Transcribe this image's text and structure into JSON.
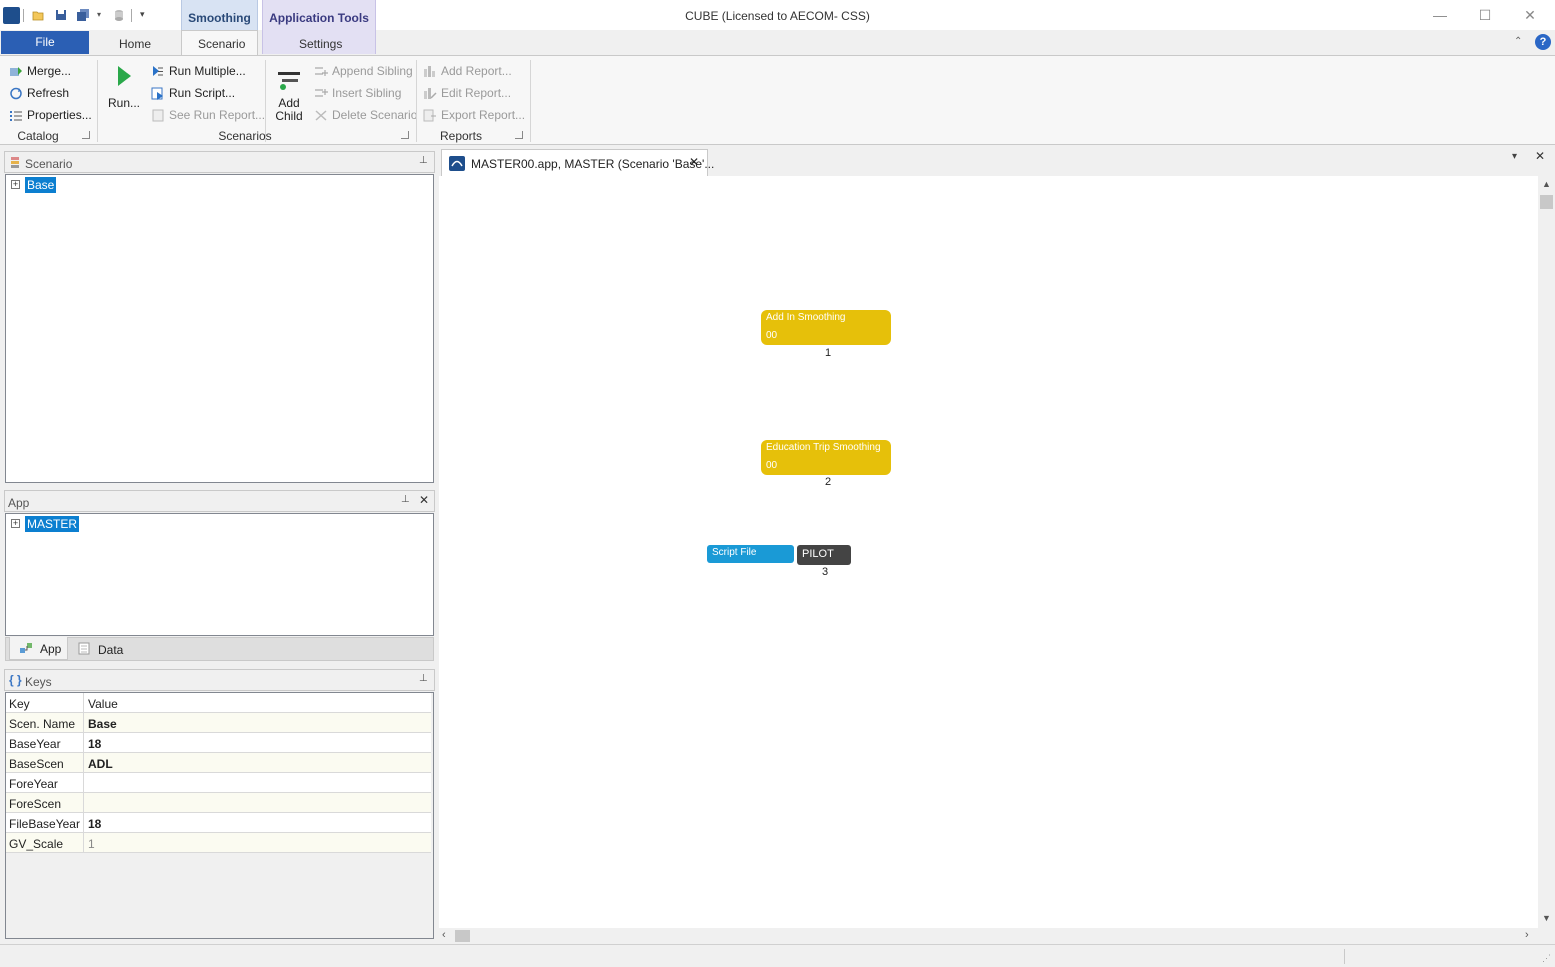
{
  "window": {
    "title": "CUBE (Licensed to AECOM- CSS)",
    "minimize": "—",
    "maximize": "☐",
    "close": "✕"
  },
  "context_tabs": {
    "smoothing": "Smoothing",
    "application_tools": "Application Tools"
  },
  "tabs": {
    "file": "File",
    "home": "Home",
    "scenario": "Scenario",
    "settings": "Settings"
  },
  "ribbon": {
    "catalog": {
      "label": "Catalog",
      "merge": "Merge...",
      "refresh": "Refresh",
      "properties": "Properties..."
    },
    "scenarios": {
      "label": "Scenarios",
      "run": "Run...",
      "run_multiple": "Run Multiple...",
      "run_script": "Run Script...",
      "see_run_report": "See Run Report...",
      "add_child_line1": "Add",
      "add_child_line2": "Child",
      "append_sibling": "Append Sibling",
      "insert_sibling": "Insert Sibling",
      "delete_scenario": "Delete Scenario"
    },
    "reports": {
      "label": "Reports",
      "add_report": "Add Report...",
      "edit_report": "Edit Report...",
      "export_report": "Export Report..."
    }
  },
  "scenario_panel": {
    "title": "Scenario",
    "root": "Base"
  },
  "app_panel": {
    "title": "App",
    "root": "MASTER",
    "tab_app": "App",
    "tab_data": "Data"
  },
  "keys_panel": {
    "title": "Keys",
    "header_key": "Key",
    "header_value": "Value",
    "rows": [
      {
        "key": "Scen. Name",
        "value": "Base"
      },
      {
        "key": "BaseYear",
        "value": "18"
      },
      {
        "key": "BaseScen",
        "value": "ADL"
      },
      {
        "key": "ForeYear",
        "value": ""
      },
      {
        "key": "ForeScen",
        "value": ""
      },
      {
        "key": "FileBaseYear",
        "value": "18"
      },
      {
        "key": "GV_Scale",
        "value": "1"
      }
    ]
  },
  "document": {
    "tab_title": "MASTER00.app, MASTER (Scenario 'Base'...",
    "nodes": [
      {
        "label": "Add In Smoothing",
        "sub": "00",
        "number": "1"
      },
      {
        "label": "Education Trip Smoothing",
        "sub": "00",
        "number": "2"
      },
      {
        "label": "Script File",
        "pilot": "PILOT",
        "number": "3"
      }
    ]
  },
  "colors": {
    "file_tab": "#2b5fb4",
    "node_yellow": "#e6c00a",
    "node_blue": "#1a9ad6",
    "node_dark": "#444444",
    "selection": "#0c7fd0"
  }
}
